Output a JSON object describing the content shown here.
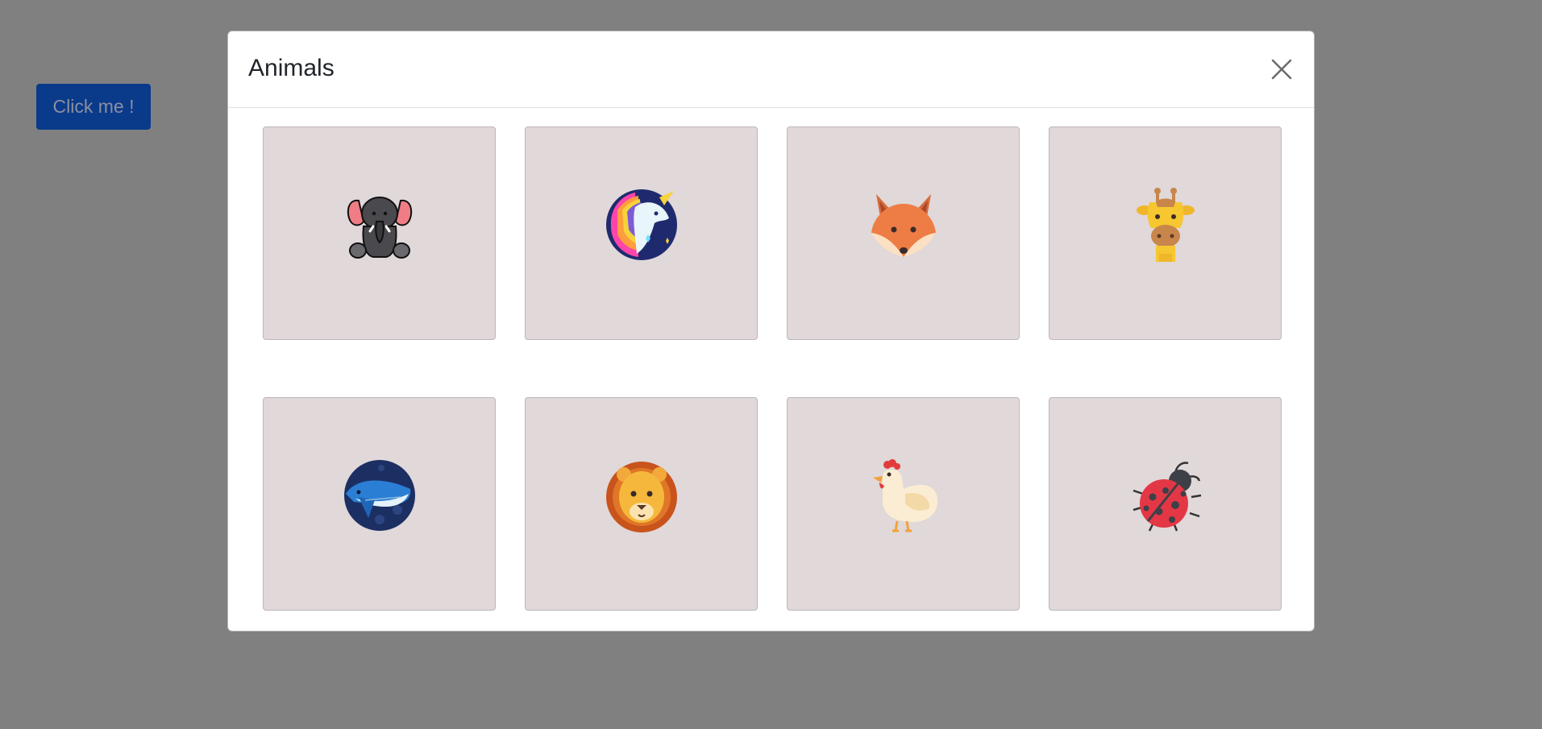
{
  "page": {
    "button_label": "Click me !"
  },
  "modal": {
    "title": "Animals",
    "close_icon": "close-icon"
  },
  "animals": [
    {
      "icon": "elephant-icon"
    },
    {
      "icon": "unicorn-icon"
    },
    {
      "icon": "fox-icon"
    },
    {
      "icon": "giraffe-icon"
    },
    {
      "icon": "whale-icon"
    },
    {
      "icon": "lion-icon"
    },
    {
      "icon": "chicken-icon"
    },
    {
      "icon": "ladybug-icon"
    }
  ],
  "colors": {
    "backdrop": "#808080",
    "button_bg": "#0a3a8a",
    "card_bg": "#e0d8d9"
  }
}
